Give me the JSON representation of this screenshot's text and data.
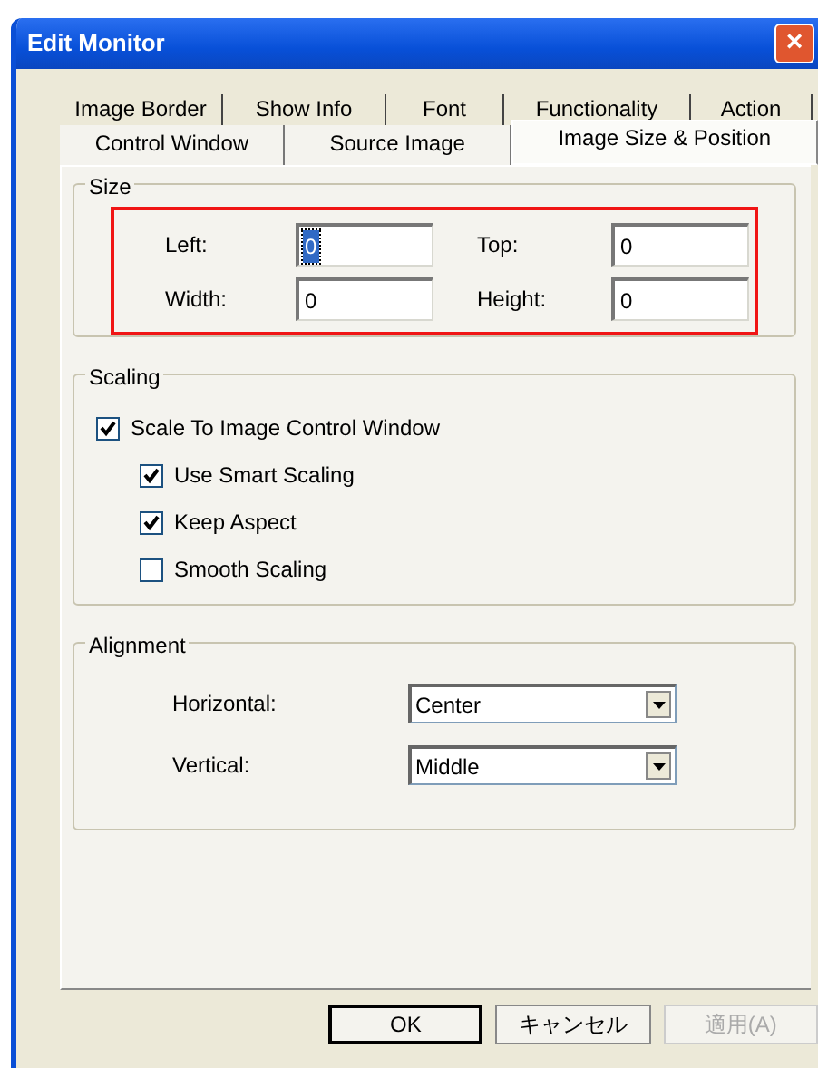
{
  "window": {
    "title": "Edit Monitor",
    "close": "×"
  },
  "tab_rows": [
    [
      {
        "label": "Image Border",
        "selected": false
      },
      {
        "label": "Show Info",
        "selected": false
      },
      {
        "label": "Font",
        "selected": false
      },
      {
        "label": "Functionality",
        "selected": false
      },
      {
        "label": "Action",
        "selected": false
      }
    ],
    [
      {
        "label": "Control Window",
        "selected": false
      },
      {
        "label": "Source Image",
        "selected": false
      },
      {
        "label": "Image Size & Position",
        "selected": true
      }
    ]
  ],
  "size": {
    "title": "Size",
    "highlighted": true,
    "fields": [
      {
        "label": "Left:",
        "value": "0",
        "selected": true
      },
      {
        "label": "Top:",
        "value": "0",
        "selected": false
      },
      {
        "label": "Width:",
        "value": "0",
        "selected": false
      },
      {
        "label": "Height:",
        "value": "0",
        "selected": false
      }
    ]
  },
  "scaling": {
    "title": "Scaling",
    "options": [
      {
        "label": "Scale To Image Control Window",
        "checked": true,
        "children": [
          {
            "label": "Use Smart Scaling",
            "checked": true
          },
          {
            "label": "Keep Aspect",
            "checked": true
          },
          {
            "label": "Smooth Scaling",
            "checked": false
          }
        ]
      }
    ]
  },
  "alignment": {
    "title": "Alignment",
    "dropdowns": [
      {
        "label": "Horizontal:",
        "value": "Center"
      },
      {
        "label": "Vertical:",
        "value": "Middle"
      }
    ]
  },
  "buttons": [
    {
      "label": "OK",
      "default": true,
      "disabled": false
    },
    {
      "label": "キャンセル",
      "default": false,
      "disabled": false
    },
    {
      "label": "適用(A)",
      "default": false,
      "disabled": true
    }
  ]
}
